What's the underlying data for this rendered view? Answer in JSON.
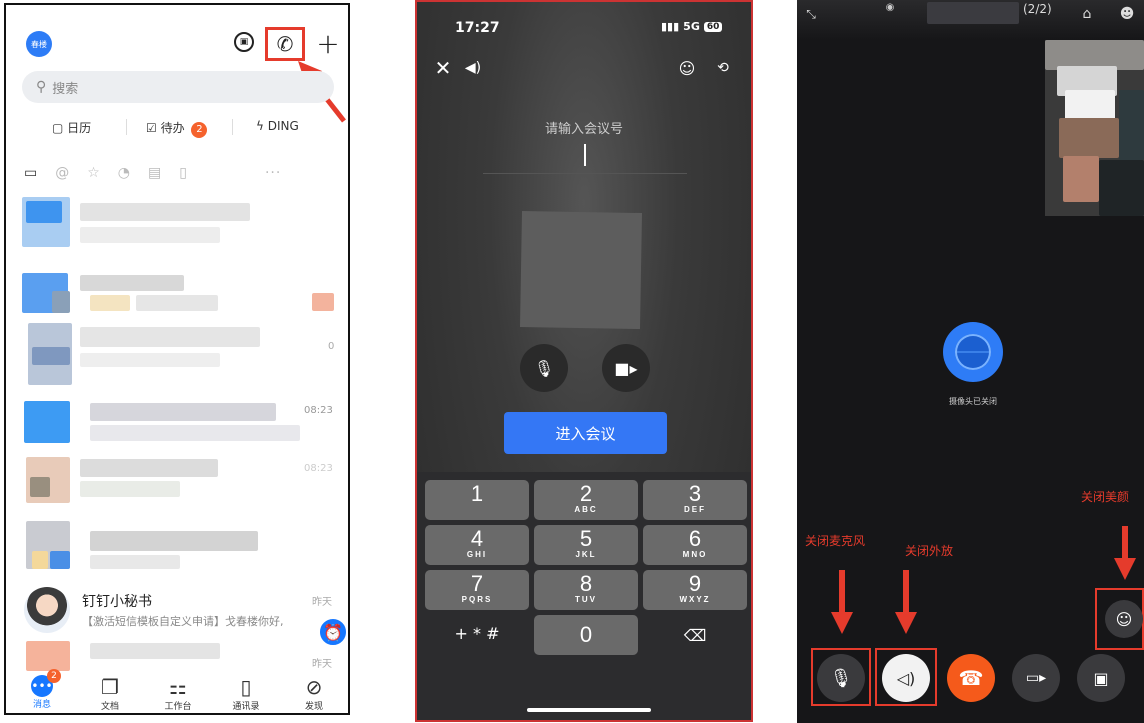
{
  "panel1": {
    "avatar_text": "春楼",
    "search_placeholder": "搜索",
    "quick": [
      {
        "icon": "calendar-icon",
        "label": "日历"
      },
      {
        "icon": "todo-icon",
        "label": "待办",
        "badge": "2"
      },
      {
        "icon": "ding-icon",
        "label": "DING"
      }
    ],
    "times": [
      "08:23",
      "0",
      "08:23",
      "昨天"
    ],
    "secretary": {
      "name": "钉钉小秘书",
      "message": "【激活短信模板自定义申请】戈春楼你好,",
      "time": "昨天"
    },
    "tabs": [
      {
        "label": "消息",
        "icon": "message-icon",
        "badge": "2"
      },
      {
        "label": "文档",
        "icon": "docs-icon"
      },
      {
        "label": "工作台",
        "icon": "workbench-icon"
      },
      {
        "label": "通讯录",
        "icon": "contacts-icon"
      },
      {
        "label": "发现",
        "icon": "discover-icon"
      }
    ],
    "accent": "#1677ff",
    "highlight": "#e53b2c"
  },
  "panel2": {
    "time": "17:27",
    "network": "5G",
    "battery": "60",
    "prompt": "请输入会议号",
    "join_label": "进入会议",
    "keys": [
      {
        "d": "1",
        "l": ""
      },
      {
        "d": "2",
        "l": "ABC"
      },
      {
        "d": "3",
        "l": "DEF"
      },
      {
        "d": "4",
        "l": "GHI"
      },
      {
        "d": "5",
        "l": "JKL"
      },
      {
        "d": "6",
        "l": "MNO"
      },
      {
        "d": "7",
        "l": "PQRS"
      },
      {
        "d": "8",
        "l": "TUV"
      },
      {
        "d": "9",
        "l": "WXYZ"
      }
    ],
    "symbols": "+ * #",
    "zero": "0"
  },
  "panel3": {
    "count": "(2/2)",
    "camera_off_text": "摄像头已关闭",
    "labels": {
      "mic": "关闭麦克风",
      "speaker": "关闭外放",
      "beauty": "关闭美颜"
    }
  }
}
